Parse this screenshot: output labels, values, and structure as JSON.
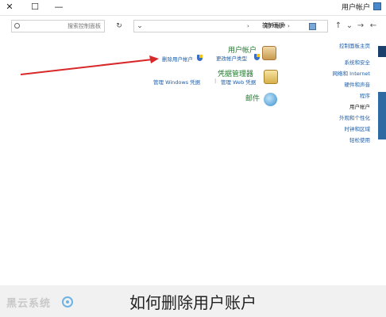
{
  "window": {
    "title": "用户帐户",
    "close_glyph": "✕",
    "maximize_glyph": "☐",
    "minimize_glyph": "—"
  },
  "toolbar": {
    "search_placeholder": "搜索控制面板",
    "refresh_glyph": "↻",
    "dropdown_glyph": "⌄",
    "back_glyph": "←",
    "forward_glyph": "→",
    "up_glyph": "↑",
    "recent_glyph": "⌄"
  },
  "address": {
    "crumb_root": "控制面板",
    "crumb_current": "用户帐户",
    "sep": "›"
  },
  "categories": {
    "user_accounts": {
      "heading": "用户帐户",
      "link1": "更改帐户类型",
      "link2": "删除用户帐户"
    },
    "credential_manager": {
      "heading": "凭据管理器",
      "link1": "管理 Web 凭据",
      "link2": "管理 Windows 凭据",
      "sep": "|"
    },
    "mail": {
      "heading": "邮件"
    }
  },
  "sidebar": {
    "items": [
      "控制面板主页",
      "系统和安全",
      "网络和 Internet",
      "硬件和声音",
      "程序",
      "用户帐户",
      "外观和个性化",
      "时钟和区域",
      "轻松使用"
    ],
    "active_index": 5
  },
  "footer": {
    "caption": "如何删除用户账户",
    "logo_text": "黑云系统"
  },
  "colors": {
    "heading_green": "#1e7c2b",
    "link_blue": "#1f5ea8",
    "arrow_red": "#d8282a",
    "stripe_blue": "#1b3f6b"
  }
}
